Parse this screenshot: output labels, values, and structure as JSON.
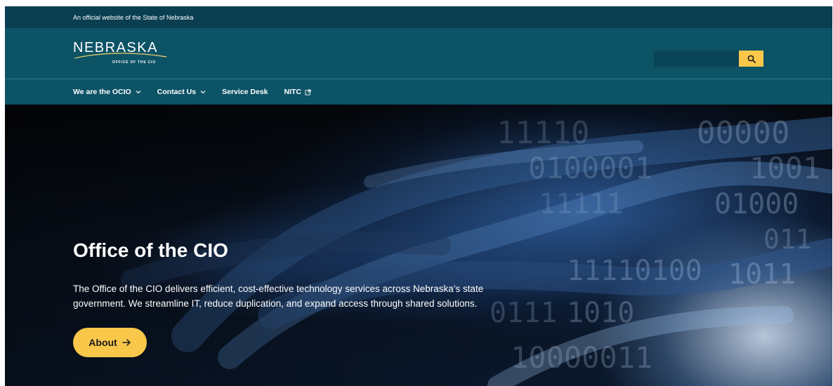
{
  "official_banner": {
    "text": "An official website of the State of Nebraska"
  },
  "header": {
    "logo": {
      "word": "NEBRASKA",
      "subtitle": "OFFICE OF THE CIO"
    },
    "search": {
      "placeholder": "",
      "icon": "search-icon"
    }
  },
  "nav": {
    "items": [
      {
        "label": "We are the OCIO",
        "icon": "chevron-down-icon"
      },
      {
        "label": "Contact Us",
        "icon": "chevron-down-icon"
      },
      {
        "label": "Service Desk"
      },
      {
        "label": "NITC",
        "icon": "external-link-icon"
      }
    ]
  },
  "hero": {
    "title": "Office of the CIO",
    "description": "The Office of the CIO delivers efficient, cost-effective technology services across Nebraska’s state government. We streamline IT, reduce duplication, and expand access through shared solutions.",
    "button_label": "About",
    "button_icon": "arrow-right-icon",
    "background_digits": [
      "11110",
      "00000",
      "0100001",
      "1001",
      "11111",
      "01000",
      "011",
      "11110100",
      "1011",
      "0111",
      "1010",
      "10000011"
    ]
  },
  "colors": {
    "banner": "#0a3f52",
    "header": "#0d5366",
    "accent": "#f9c74a",
    "hero_dark": "#05070c"
  }
}
